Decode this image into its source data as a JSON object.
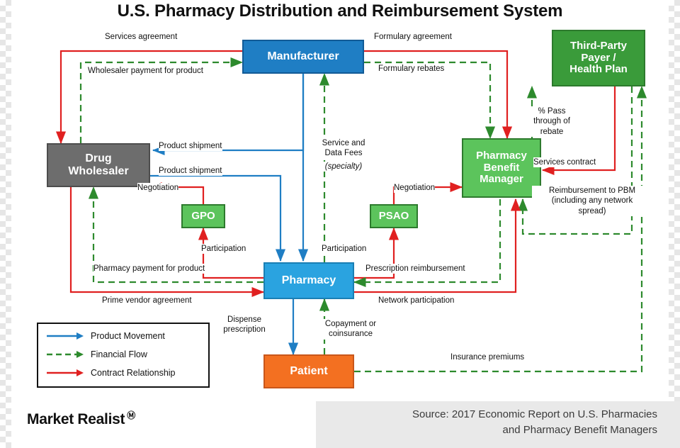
{
  "title": "U.S. Pharmacy Distribution and Reimbursement System",
  "nodes": {
    "manufacturer": "Manufacturer",
    "third_party_payer": "Third-Party\nPayer /\nHealth Plan",
    "drug_wholesaler": "Drug\nWholesaler",
    "pbm": "Pharmacy\nBenefit\nManager",
    "gpo": "GPO",
    "psao": "PSAO",
    "pharmacy": "Pharmacy",
    "patient": "Patient"
  },
  "edge_labels": {
    "services_agreement": "Services agreement",
    "formulary_agreement": "Formulary agreement",
    "wholesaler_payment": "Wholesaler payment for product",
    "formulary_rebates": "Formulary rebates",
    "pass_through_rebate": "% Pass\nthrough of\nrebate",
    "product_shipment_1": "Product shipment",
    "service_and_data_fees": "Service and\nData Fees",
    "service_and_data_fees_specialty": "(specialty)",
    "services_contract": "Services contract",
    "product_shipment_2": "Product shipment",
    "negotiation_left": "Negotiation",
    "negotiation_right": "Negotiation",
    "reimbursement_to_pbm": "Reimbursement to PBM\n(including any  network\nspread)",
    "participation_left": "Participation",
    "participation_right": "Participation",
    "pharmacy_payment": "Pharmacy payment for product",
    "prescription_reimbursement": "Prescription reimbursement",
    "prime_vendor_agreement": "Prime vendor agreement",
    "network_participation": "Network participation",
    "dispense_prescription": "Dispense\nprescription",
    "copayment_or_coinsurance": "Copayment or\ncoinsurance",
    "insurance_premiums": "Insurance premiums"
  },
  "legend": {
    "items": [
      {
        "label": "Product Movement",
        "color": "#1f7ec4",
        "style": "solid"
      },
      {
        "label": "Financial Flow",
        "color": "#2d8a2d",
        "style": "dashed"
      },
      {
        "label": "Contract Relationship",
        "color": "#e02020",
        "style": "solid"
      }
    ]
  },
  "footer": {
    "brand": "Market Realist",
    "brand_mark": "Ⓜ",
    "source": "Source: 2017 Economic Report on U.S. Pharmacies\nand Pharmacy Benefit Managers"
  },
  "colors": {
    "product_movement": "#1f7ec4",
    "financial_flow": "#2d8a2d",
    "contract_relationship": "#e02020",
    "manufacturer": "#1f7ec4",
    "payer": "#3a9b3a",
    "wholesaler": "#6d6d6d",
    "pbm": "#5cc45c",
    "pharmacy": "#2aa3e0",
    "patient": "#f37021"
  }
}
